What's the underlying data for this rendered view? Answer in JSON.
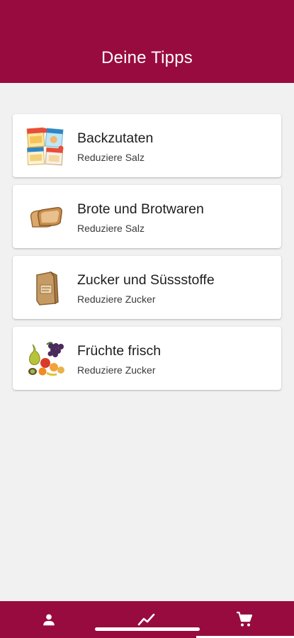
{
  "header": {
    "title": "Deine Tipps"
  },
  "tips": [
    {
      "title": "Backzutaten",
      "subtitle": "Reduziere Salz",
      "icon": "baking-ingredients-icon"
    },
    {
      "title": "Brote und Brotwaren",
      "subtitle": "Reduziere Salz",
      "icon": "bread-icon"
    },
    {
      "title": "Zucker und Süssstoffe",
      "subtitle": "Reduziere Zucker",
      "icon": "sugar-bag-icon"
    },
    {
      "title": "Früchte frisch",
      "subtitle": "Reduziere Zucker",
      "icon": "fruit-icon"
    }
  ],
  "tabbar": {
    "tabs": [
      {
        "icon": "person-icon"
      },
      {
        "icon": "trend-line-icon"
      },
      {
        "icon": "shopping-cart-icon",
        "active": true
      }
    ]
  },
  "colors": {
    "brand": "#980b3e",
    "background": "#f1f1f1",
    "card": "#ffffff"
  }
}
